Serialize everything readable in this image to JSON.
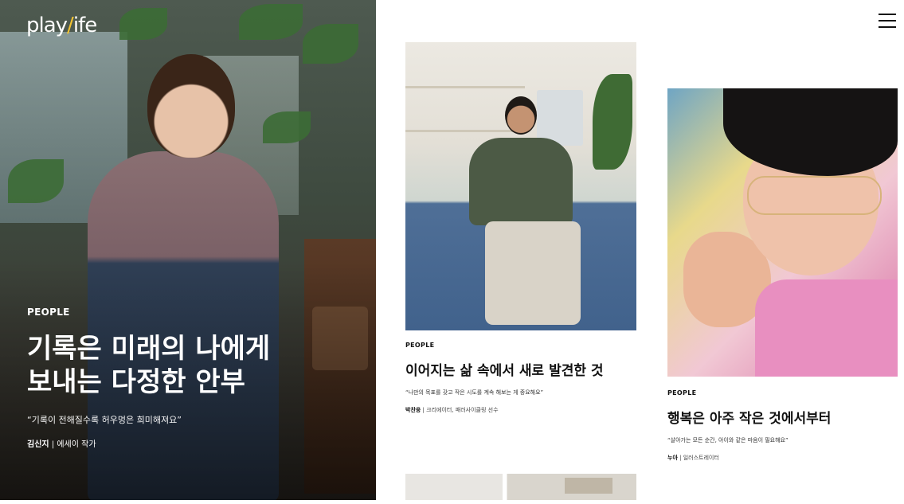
{
  "brand": {
    "logo_text_a": "play",
    "logo_slash": "/",
    "logo_text_b": "ife",
    "accent_color": "#f2c230"
  },
  "menu": {
    "icon": "hamburger-menu-icon"
  },
  "hero": {
    "category": "PEOPLE",
    "title_line1": "기록은 미래의 나에게",
    "title_line2": "보내는 다정한 안부",
    "quote": "“기록이 전해질수록 허우멍은 희미해져요”",
    "author_name": "김신지",
    "author_role": " | 에세이 작가"
  },
  "cards": [
    {
      "category": "PEOPLE",
      "title": "이어지는 삶 속에서 새로 발견한 것",
      "quote": "“나만의 목표를 갖고 작은 시도를 계속 해보는 게 중요해요”",
      "author_name": "박찬웅",
      "author_role": " | 크리에이터, 패러사이클링 선수"
    },
    {
      "category": "PEOPLE",
      "title": "행복은 아주 작은 것에서부터",
      "quote": "“살아가는 모든 순간, 아이와 같은 마음이 필요해요”",
      "author_name": "누아",
      "author_role": " | 일러스트레이터"
    }
  ]
}
